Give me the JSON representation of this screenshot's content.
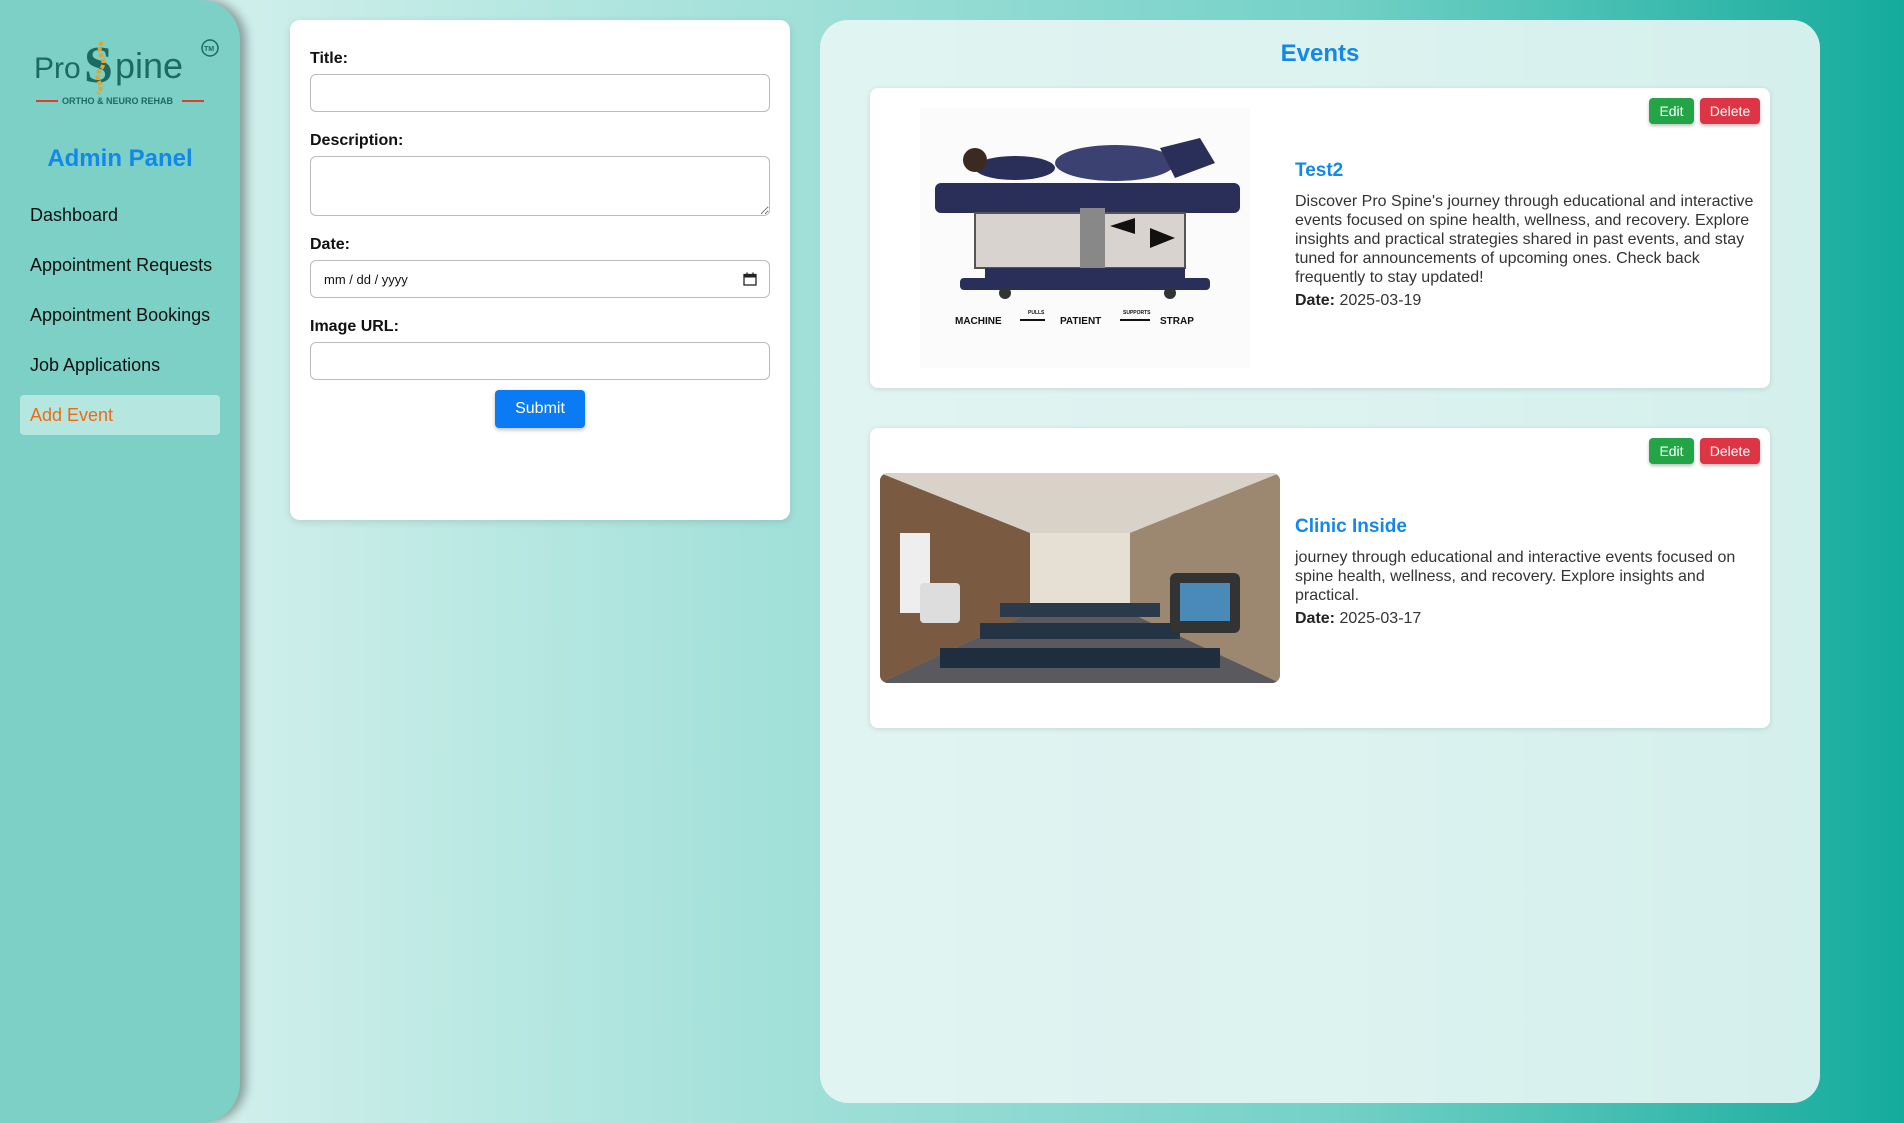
{
  "brand": {
    "logo_pro": "Pro",
    "logo_spine": "Spine",
    "logo_tm": "TM",
    "logo_tagline": "ORTHO & NEURO REHAB"
  },
  "sidebar": {
    "title": "Admin Panel",
    "items": [
      {
        "label": "Dashboard",
        "active": false
      },
      {
        "label": "Appointment Requests",
        "active": false
      },
      {
        "label": "Appointment Bookings",
        "active": false
      },
      {
        "label": "Job Applications",
        "active": false
      },
      {
        "label": "Add Event",
        "active": true
      }
    ]
  },
  "form": {
    "title_label": "Title:",
    "title_value": "",
    "description_label": "Description:",
    "description_value": "",
    "date_label": "Date:",
    "date_placeholder": "mm / dd / yyyy",
    "image_label": "Image URL:",
    "image_value": "",
    "submit_label": "Submit"
  },
  "events": {
    "heading": "Events",
    "items": [
      {
        "title": "Test2",
        "description": "Discover Pro Spine's journey through educational and interactive events focused on spine health, wellness, and recovery. Explore insights and practical strategies shared in past events, and stay tuned for announcements of upcoming ones. Check back frequently to stay updated!",
        "date_label": "Date:",
        "date": "2025-03-19",
        "edit_label": "Edit",
        "delete_label": "Delete",
        "image_captions": {
          "machine": "MACHINE",
          "patient": "PATIENT",
          "strap": "STRAP",
          "pulls": "PULLS",
          "supports": "SUPPORTS"
        }
      },
      {
        "title": "Clinic Inside",
        "description": "journey through educational and interactive events focused on spine health, wellness, and recovery. Explore insights and practical.",
        "date_label": "Date:",
        "date": "2025-03-17",
        "edit_label": "Edit",
        "delete_label": "Delete"
      }
    ]
  },
  "colors": {
    "accent_blue": "#1488e8",
    "active_orange": "#f06a14",
    "edit_green": "#23a547",
    "delete_red": "#dc3545",
    "submit_blue": "#0b7bf5"
  }
}
